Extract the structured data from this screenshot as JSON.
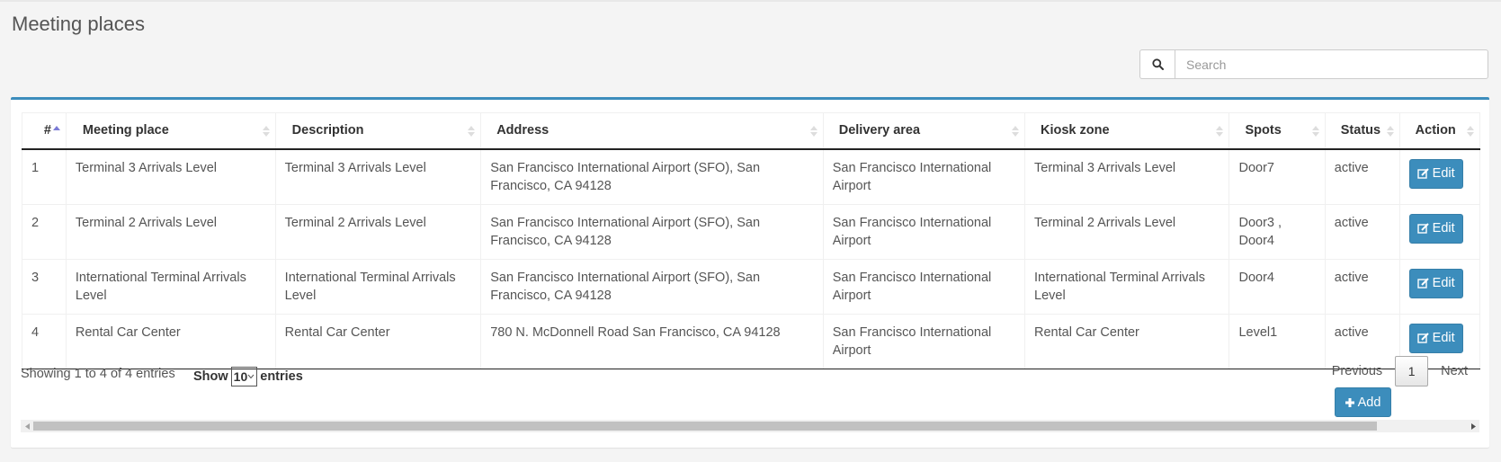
{
  "page": {
    "title": "Meeting places"
  },
  "search": {
    "placeholder": "Search",
    "value": "",
    "icon": "search-icon"
  },
  "colors": {
    "accent": "#3c8dbc",
    "background": "#f4f4f4"
  },
  "table": {
    "columns": [
      "#",
      "Meeting place",
      "Description",
      "Address",
      "Delivery area",
      "Kiosk zone",
      "Spots",
      "Status",
      "Action"
    ],
    "rows": [
      {
        "num": "1",
        "meeting_place": "Terminal 3 Arrivals Level",
        "description": "Terminal 3 Arrivals Level",
        "address": "San Francisco International Airport (SFO), San Francisco, CA 94128",
        "delivery_area": "San Francisco International Airport",
        "kiosk_zone": "Terminal 3 Arrivals Level",
        "spots": "Door7",
        "status": "active",
        "action": "Edit"
      },
      {
        "num": "2",
        "meeting_place": "Terminal 2 Arrivals Level",
        "description": "Terminal 2 Arrivals Level",
        "address": "San Francisco International Airport (SFO), San Francisco, CA 94128",
        "delivery_area": "San Francisco International Airport",
        "kiosk_zone": "Terminal 2 Arrivals Level",
        "spots": "Door3 , Door4",
        "status": "active",
        "action": "Edit"
      },
      {
        "num": "3",
        "meeting_place": "International Terminal Arrivals Level",
        "description": "International Terminal Arrivals Level",
        "address": "San Francisco International Airport (SFO), San Francisco, CA 94128",
        "delivery_area": "San Francisco International Airport",
        "kiosk_zone": "International Terminal Arrivals Level",
        "spots": "Door4",
        "status": "active",
        "action": "Edit"
      },
      {
        "num": "4",
        "meeting_place": "Rental Car Center",
        "description": "Rental Car Center",
        "address": "780 N. McDonnell Road San Francisco, CA 94128",
        "delivery_area": "San Francisco International Airport",
        "kiosk_zone": "Rental Car Center",
        "spots": "Level1",
        "status": "active",
        "action": "Edit"
      }
    ]
  },
  "footer": {
    "info": "Showing 1 to 4 of 4 entries",
    "show_label": "Show",
    "show_value": "10",
    "entries_label": "entries",
    "previous": "Previous",
    "current_page": "1",
    "next": "Next",
    "add_label": "Add"
  }
}
